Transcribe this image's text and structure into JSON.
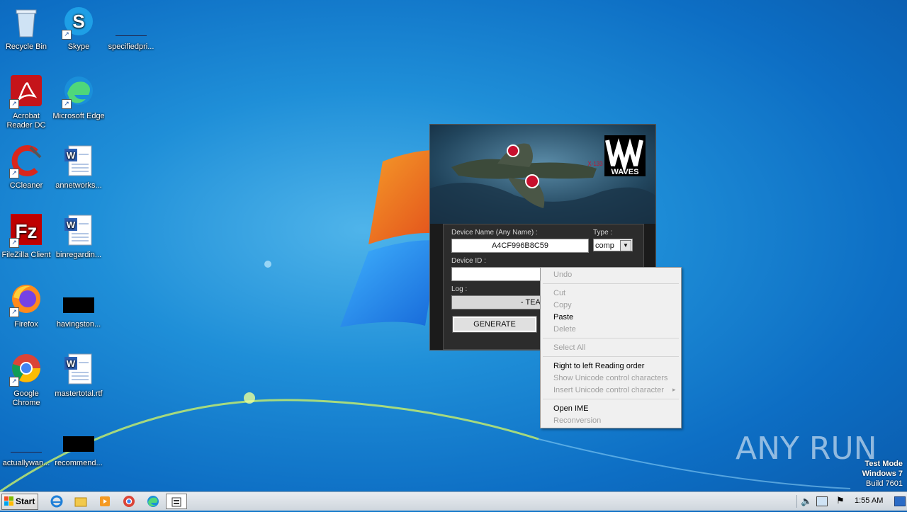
{
  "desktop": {
    "icons": [
      {
        "label": "Recycle Bin",
        "icon": "recycle-bin-icon"
      },
      {
        "label": "Skype",
        "icon": "skype-icon"
      },
      {
        "label": "specifiedpri...",
        "icon": "blank-file-icon"
      },
      {
        "label": "Acrobat Reader DC",
        "label_line1": "Acrobat",
        "label_line2": "Reader DC",
        "icon": "acrobat-icon"
      },
      {
        "label": "Microsoft Edge",
        "icon": "edge-icon"
      },
      {
        "label": "CCleaner",
        "icon": "ccleaner-icon"
      },
      {
        "label": "annetworks...",
        "icon": "word-doc-icon"
      },
      {
        "label": "FileZilla Client",
        "icon": "filezilla-icon"
      },
      {
        "label": "binregardin...",
        "icon": "word-doc-icon"
      },
      {
        "label": "Firefox",
        "icon": "firefox-icon"
      },
      {
        "label": "havingston...",
        "icon": "black-thumbnail-icon"
      },
      {
        "label": "Google Chrome",
        "label_line1": "Google",
        "label_line2": "Chrome",
        "icon": "chrome-icon"
      },
      {
        "label": "mastertotal.rtf",
        "icon": "word-doc-icon"
      },
      {
        "label": "actuallywan...",
        "icon": "blank-file-icon"
      },
      {
        "label": "recommend...",
        "icon": "black-thumbnail-icon"
      }
    ]
  },
  "keygen": {
    "logo_text": "WAVES",
    "plane_marking": "X-133",
    "device_name_label": "Device Name (Any Name) :",
    "device_name_value": "A4CF996B8C59",
    "type_label": "Type :",
    "type_value": "comp",
    "device_id_label": "Device ID :",
    "device_id_value": "",
    "log_label": "Log :",
    "log_value": "- TEAM R2R",
    "generate_label": "GENERATE"
  },
  "context_menu": {
    "undo": "Undo",
    "cut": "Cut",
    "copy": "Copy",
    "paste": "Paste",
    "delete": "Delete",
    "select_all": "Select All",
    "rtl": "Right to left Reading order",
    "show_unicode": "Show Unicode control characters",
    "insert_unicode": "Insert Unicode control character",
    "open_ime": "Open IME",
    "reconversion": "Reconversion"
  },
  "watermark": {
    "brand": "ANY RUN",
    "test_mode": "Test Mode",
    "os": "Windows 7",
    "build": "Build 7601"
  },
  "taskbar": {
    "start_label": "Start",
    "clock": "1:55 AM",
    "pinned": [
      "ie-icon",
      "explorer-icon",
      "media-player-icon",
      "chrome-icon",
      "edge-icon",
      "keygen-app-icon"
    ]
  },
  "colors": {
    "desktop_blue": "#1f8fd8",
    "taskbar": "#dfe3e8",
    "menu_bg": "#f0f0f0",
    "disabled_text": "#a0a0a0"
  }
}
